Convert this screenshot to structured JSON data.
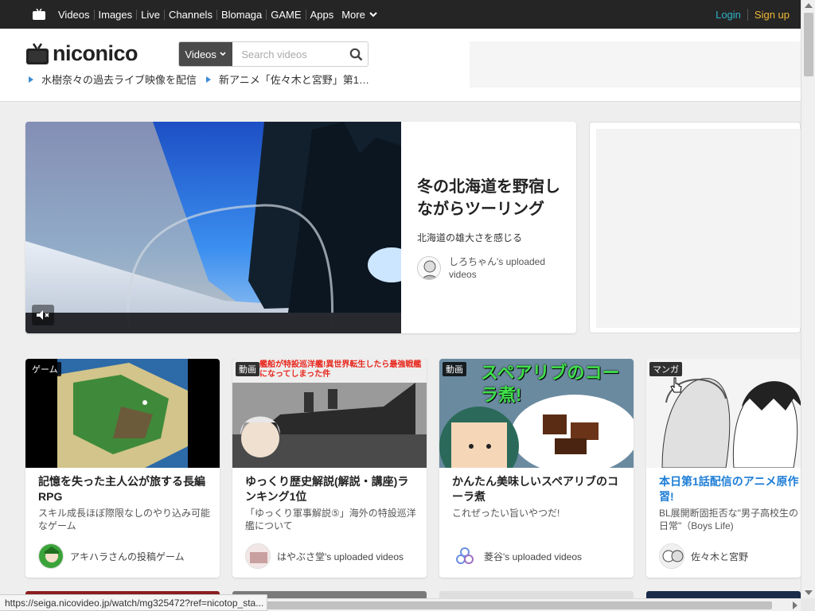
{
  "topbar": {
    "nav": [
      "Videos",
      "Images",
      "Live",
      "Channels",
      "Blomaga",
      "GAME",
      "Apps"
    ],
    "more_label": "More",
    "login_label": "Login",
    "signup_label": "Sign up"
  },
  "header": {
    "logo_text": "niconico",
    "search": {
      "category": "Videos",
      "placeholder": "Search videos",
      "value": ""
    },
    "news": [
      "水樹奈々の過去ライブ映像を配信",
      "新アニメ「佐々木と宮野」第1…"
    ]
  },
  "hero": {
    "title": "冬の北海道を野宿しながらツーリング",
    "subtitle": "北海道の雄大さを感じる",
    "owner": "しろちゃん's uploaded videos"
  },
  "cards": [
    {
      "badge": "ゲーム",
      "title": "記憶を失った主人公が旅する長編RPG",
      "desc": "スキル成長ほぼ際限なしのやり込み可能なゲーム",
      "owner": "アキハラさんの投稿ゲーム",
      "title_color": "#222222"
    },
    {
      "badge": "動画",
      "thumb_caption": "艦船が特設巡洋艦!異世界転生したら最強戦艦になってしまった件",
      "title": "ゆっくり歴史解説(解説・講座)ランキング1位",
      "desc": "「ゆっくり軍事解説⑤」海外の特設巡洋艦について",
      "owner": "はやぶさ堂's uploaded videos",
      "title_color": "#222222"
    },
    {
      "badge": "動画",
      "thumb_caption": "スペアリブのコーラ煮!",
      "title": "かんたん美味しいスペアリブのコーラ煮",
      "desc": "これぜったい旨いやつだ!",
      "owner": "菱谷's uploaded videos",
      "title_color": "#222222"
    },
    {
      "badge": "マンガ",
      "title": "本日第1話配信のアニメ原作習!",
      "desc": "BL展開断固拒否な\"男子高校生の日常\"（Boys Life)",
      "owner": "佐々木と宮野",
      "title_color": "#1c7dd6"
    }
  ],
  "status_url": "https://seiga.nicovideo.jp/watch/mg325472?ref=nicotop_sta...",
  "colors": {
    "topbar_bg": "#252525",
    "login": "#2fb3c8",
    "signup": "#f0b93a",
    "accent_link": "#1c7dd6"
  }
}
